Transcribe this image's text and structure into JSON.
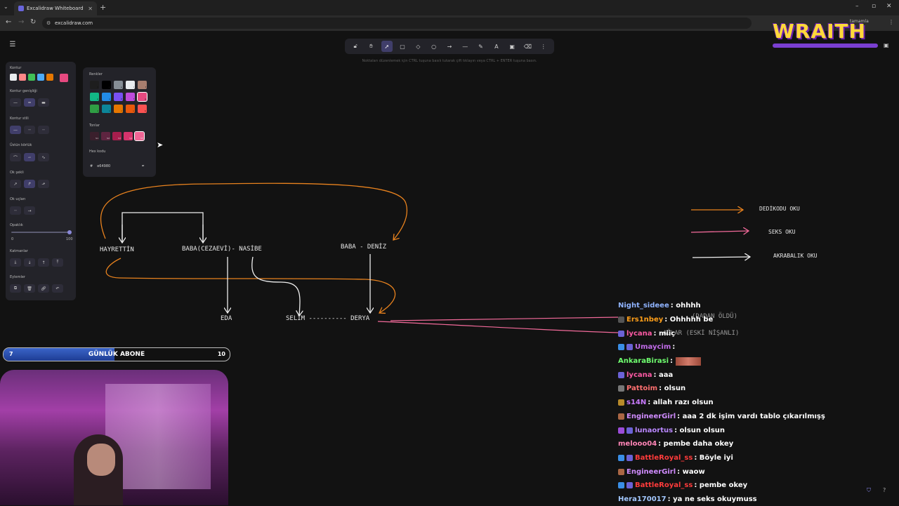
{
  "browser": {
    "tab_title": "Excalidraw Whiteboard",
    "url": "excalidraw.com",
    "addr_right_text": "tamamla"
  },
  "toolbar": {
    "tools": [
      "lock",
      "hand",
      "selection",
      "rectangle",
      "diamond",
      "ellipse",
      "arrow",
      "line",
      "draw",
      "text",
      "image",
      "eraser",
      "more"
    ],
    "active_tool": "selection",
    "hint": "Noktaları düzenlemek için CTRL tuşuna basılı tutarak çift tıklayın veya CTRL + ENTER tuşuna basın."
  },
  "props": {
    "stroke_label": "Kontur",
    "stroke_colors": [
      "#e9ecef",
      "#ff8787",
      "#40c057",
      "#4dabf7",
      "#e67700",
      "#e64980"
    ],
    "stroke_width_label": "Kontur genişliği",
    "stroke_style_label": "Kontur stili",
    "sloppiness_label": "Üstün körlük",
    "arrow_type_label": "Ok şekli",
    "arrowheads_label": "Ok uçları",
    "opacity_label": "Opaklık",
    "opacity_min": "0",
    "opacity_max": "100",
    "layers_label": "Katmanlar",
    "actions_label": "Eylemler"
  },
  "picker": {
    "colors_label": "Renkler",
    "shades_label": "Tonlar",
    "hex_label": "Hex kodu",
    "hex_value": "e64980",
    "hash": "#",
    "palette": [
      [
        "#1e1e1e",
        "#000000",
        "#868e96",
        "#e9ecef",
        "#a87e6f"
      ],
      [
        "#12b886",
        "#228be6",
        "#7950f2",
        "#be4bdb",
        "#e64980"
      ],
      [
        "#2f9e44",
        "#0c8599",
        "#e67700",
        "#e8590c",
        "#fa5252"
      ]
    ],
    "palette_keys": [
      [
        "q",
        "w",
        "e",
        "r",
        "t"
      ],
      [
        "a",
        "s",
        "d",
        "f",
        "g"
      ],
      [
        "z",
        "x",
        "c",
        "v",
        "b"
      ]
    ],
    "shades": [
      "#3a1f2c",
      "#5e2440",
      "#a61e4d",
      "#d6336c",
      "#f06595"
    ],
    "shade_keys": [
      "S1",
      "S2",
      "S3",
      "S4",
      "S5"
    ]
  },
  "canvas": {
    "hayrettin": "HAYRETTİN",
    "baba_nasibe": "BABA(CEZAEVİ)- NASİBE",
    "baba_deniz": "BABA - DENİZ",
    "eda": "EDA",
    "selim_derya": "SELİM ---------- DERYA",
    "derya": "DERYA",
    "hidden1": "(DADAN ÖLDÜ)",
    "hidden2": "AĞLAR (ESKİ NİŞANLI)"
  },
  "legend": {
    "gossip": "DEDİKODU OKU",
    "sex": "SEKS OKU",
    "kinship": "AKRABALIK OKU",
    "colors": {
      "gossip": "#e8821e",
      "sex": "#f26a9a",
      "kinship": "#f2f2f2"
    }
  },
  "sub_goal": {
    "label": "GÜNLÜK ABONE",
    "current": "7",
    "goal": "10",
    "progress": 0.7
  },
  "logo": {
    "text": "WRAITH"
  },
  "chat": [
    {
      "user": "Night_sideee",
      "msg": ": ohhhh",
      "color": "#8fb3ff",
      "badges": []
    },
    {
      "user": "Ers1nbey",
      "msg": ": Ohhhhh be",
      "color": "#ff9f1a",
      "badges": [
        "#555555"
      ]
    },
    {
      "user": "lycana",
      "msg": ": miiç",
      "color": "#ff5aa5",
      "badges": [
        "#6b62d6"
      ]
    },
    {
      "user": "Umaycim",
      "msg": ":",
      "color": "#c06be8",
      "badges": [
        "#3a8ee6",
        "#6b62d6"
      ]
    },
    {
      "user": "AnkaraBirasi",
      "msg": ":",
      "color": "#6fff6f",
      "badges": []
    },
    {
      "user": "lycana",
      "msg": ": aaa",
      "color": "#ff5aa5",
      "badges": [
        "#6b62d6"
      ]
    },
    {
      "user": "Pattoim",
      "msg": ": olsun",
      "color": "#ff7070",
      "badges": [
        "#777777"
      ]
    },
    {
      "user": "s14N",
      "msg": ": allah razı olsun",
      "color": "#c97bff",
      "badges": [
        "#b88a2a"
      ]
    },
    {
      "user": "EngineerGirl",
      "msg": ": aaa 2 dk işim vardı tablo çıkarılmışş",
      "color": "#d08cff",
      "badges": [
        "#aa6644"
      ]
    },
    {
      "user": "lunaortus",
      "msg": ": olsun olsun",
      "color": "#b987ff",
      "badges": [
        "#9b4cd9",
        "#6b62d6"
      ]
    },
    {
      "user": "melooo04",
      "msg": ": pembe daha okey",
      "color": "#ff85b6",
      "badges": []
    },
    {
      "user": "BattleRoyal_ss",
      "msg": ": Böyle iyi",
      "color": "#ff3b3b",
      "badges": [
        "#3a8ee6",
        "#6b62d6"
      ]
    },
    {
      "user": "EngineerGirl",
      "msg": ": waow",
      "color": "#d08cff",
      "badges": [
        "#aa6644"
      ]
    },
    {
      "user": "BattleRoyal_ss",
      "msg": ": pembe okey",
      "color": "#ff3b3b",
      "badges": [
        "#3a8ee6",
        "#6b62d6"
      ]
    },
    {
      "user": "Hera170017",
      "msg": ": ya ne seks okuymuss",
      "color": "#a3c8ff",
      "badges": []
    }
  ]
}
